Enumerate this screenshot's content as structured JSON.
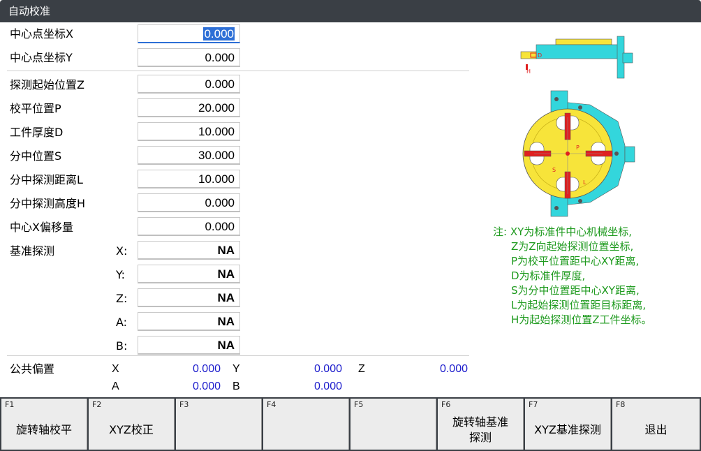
{
  "window": {
    "title": "自动校准"
  },
  "fields": {
    "center_x": {
      "label": "中心点坐标X",
      "value": "0.000"
    },
    "center_y": {
      "label": "中心点坐标Y",
      "value": "0.000"
    },
    "probe_start_z": {
      "label": "探测起始位置Z",
      "value": "0.000"
    },
    "level_p": {
      "label": "校平位置P",
      "value": "20.000"
    },
    "thickness_d": {
      "label": "工件厚度D",
      "value": "10.000"
    },
    "split_s": {
      "label": "分中位置S",
      "value": "30.000"
    },
    "split_dist_l": {
      "label": "分中探测距离L",
      "value": "10.000"
    },
    "split_height_h": {
      "label": "分中探测高度H",
      "value": "0.000"
    },
    "center_x_offset": {
      "label": "中心X偏移量",
      "value": "0.000"
    }
  },
  "reference_probe": {
    "label": "基准探测",
    "axes": [
      {
        "axis": "X:",
        "value": "NA"
      },
      {
        "axis": "Y:",
        "value": "NA"
      },
      {
        "axis": "Z:",
        "value": "NA"
      },
      {
        "axis": "A:",
        "value": "NA"
      },
      {
        "axis": "B:",
        "value": "NA"
      }
    ]
  },
  "public_offset": {
    "label": "公共偏置",
    "x_label": "X",
    "x": "0.000",
    "y_label": "Y",
    "y": "0.000",
    "z_label": "Z",
    "z": "0.000",
    "a_label": "A",
    "a": "0.000",
    "b_label": "B",
    "b": "0.000"
  },
  "diagram": {
    "label_d": "D",
    "label_h": "H",
    "label_p": "P",
    "label_s": "S",
    "label_l": "L"
  },
  "note": {
    "lines": [
      "注: XY为标准件中心机械坐标,",
      "Z为Z向起始探测位置坐标,",
      "P为校平位置距中心XY距离,",
      "D为标准件厚度,",
      "S为分中位置距中心XY距离,",
      "L为起始探测位置距目标距离,",
      "H为起始探测位置Z工件坐标。"
    ]
  },
  "function_keys": [
    {
      "key": "F1",
      "label": "旋转轴校平"
    },
    {
      "key": "F2",
      "label": "XYZ校正"
    },
    {
      "key": "F3",
      "label": ""
    },
    {
      "key": "F4",
      "label": ""
    },
    {
      "key": "F5",
      "label": ""
    },
    {
      "key": "F6",
      "label": "旋转轴基准\n探测"
    },
    {
      "key": "F7",
      "label": "XYZ基准探测"
    },
    {
      "key": "F8",
      "label": "退出"
    }
  ],
  "colors": {
    "title_bg": "#3a3f45",
    "note": "#1e9a1e",
    "value_blue": "#1c1ccc",
    "highlight": "#2d6fd6",
    "fixture_cyan": "#33d6dc",
    "fixture_yellow": "#f7e43a",
    "probe_red": "#e02020"
  }
}
